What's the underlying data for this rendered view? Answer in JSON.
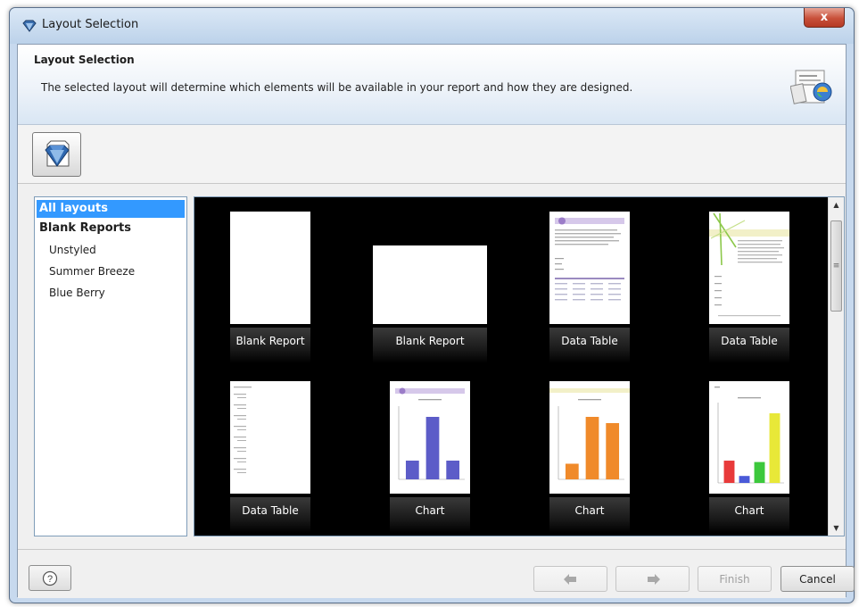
{
  "window": {
    "title": "Layout Selection",
    "close_label": "x"
  },
  "header": {
    "title": "Layout Selection",
    "description": "The selected layout will determine which elements will be available in your report and how they are designed.",
    "icon": "report-designer-icon"
  },
  "toolbar": {
    "layout_button_icon": "layout-diamond-icon"
  },
  "sidebar": {
    "items": [
      {
        "label": "All layouts",
        "selected": true
      },
      {
        "label": "Blank Reports",
        "selected": false
      },
      {
        "label": "Unstyled",
        "selected": false
      },
      {
        "label": "Summer Breeze",
        "selected": false
      },
      {
        "label": "Blue Berry",
        "selected": false
      }
    ]
  },
  "gallery": {
    "tiles": [
      {
        "caption": "Blank Report",
        "kind": "blank-portrait"
      },
      {
        "caption": "Blank Report",
        "kind": "blank-landscape"
      },
      {
        "caption": "Data Table",
        "kind": "table-purple"
      },
      {
        "caption": "Data Table",
        "kind": "table-green"
      },
      {
        "caption": "Data Table",
        "kind": "table-plain"
      },
      {
        "caption": "Chart",
        "kind": "chart-purple",
        "bar_colors": [
          "#5c5cc8"
        ],
        "bar_levels": [
          0.3,
          1.0,
          0.3
        ]
      },
      {
        "caption": "Chart",
        "kind": "chart-orange",
        "bar_colors": [
          "#f08a2a"
        ],
        "bar_levels": [
          0.25,
          1.0,
          0.9
        ]
      },
      {
        "caption": "Chart",
        "kind": "chart-multi",
        "bar_colors": [
          "#e83a3a",
          "#4a5ad8",
          "#3cc83c",
          "#e8e838"
        ],
        "bar_levels": [
          0.32,
          0.1,
          0.3,
          1.0
        ]
      }
    ]
  },
  "footer": {
    "help_icon": "question-mark-icon",
    "back_icon": "back-arrow-icon",
    "next_icon": "next-arrow-icon",
    "finish_label": "Finish",
    "cancel_label": "Cancel"
  },
  "colors": {
    "selection": "#3399ff",
    "gallery_background": "#000000"
  }
}
